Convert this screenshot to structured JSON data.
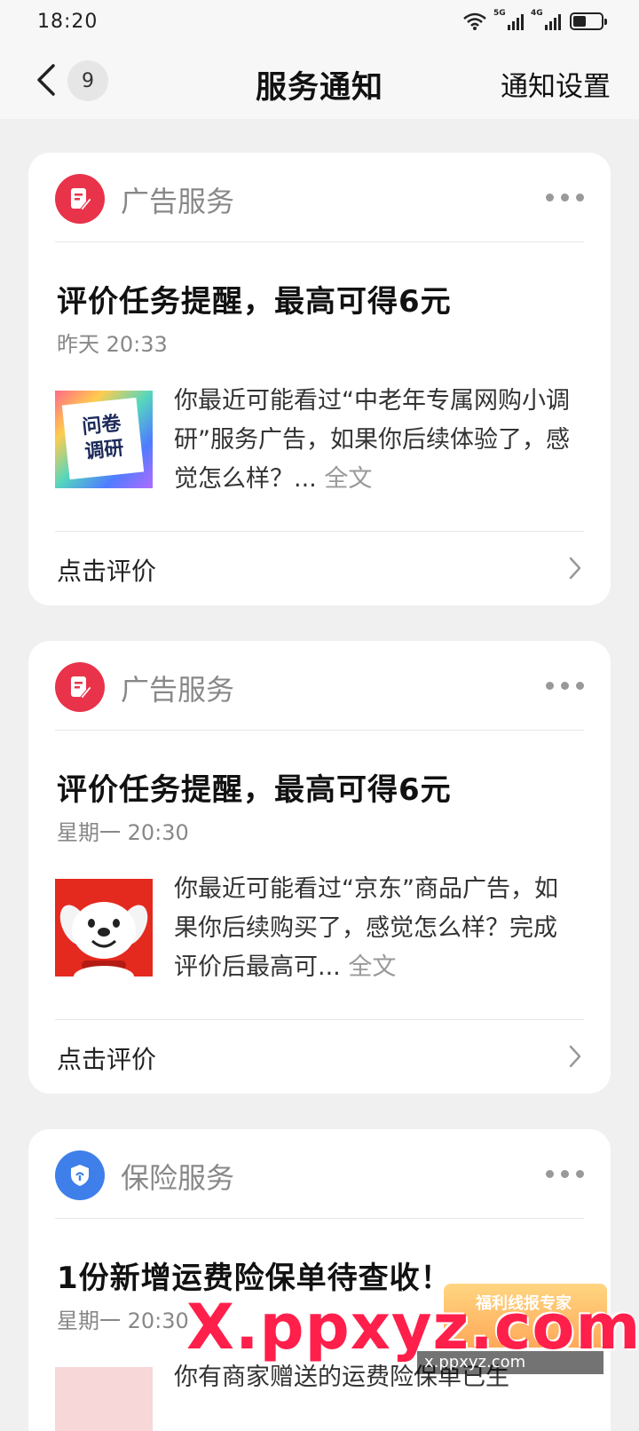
{
  "status_bar": {
    "time": "18:20",
    "signal_1_label": "5G",
    "signal_2_label": "4G",
    "icons": [
      "wifi-icon",
      "signal-icon",
      "signal-icon",
      "battery-icon"
    ]
  },
  "header": {
    "back_icon": "chevron-left-icon",
    "unread_count": "9",
    "title": "服务通知",
    "settings_label": "通知设置"
  },
  "notifications": [
    {
      "service_name": "广告服务",
      "service_icon": "document-pen-icon",
      "title": "评价任务提醒，最高可得6元",
      "time": "昨天 20:33",
      "thumbnail": "survey-thumbnail",
      "thumbnail_text_1": "问卷",
      "thumbnail_text_2": "调研",
      "body": "你最近可能看过“中老年专属网购小调研”服务广告，如果你后续体验了，感觉怎么样？...",
      "full_text_label": "全文",
      "action_label": "点击评价"
    },
    {
      "service_name": "广告服务",
      "service_icon": "document-pen-icon",
      "title": "评价任务提醒，最高可得6元",
      "time": "星期一 20:30",
      "thumbnail": "jd-dog-thumbnail",
      "body": "你最近可能看过“京东”商品广告，如果你后续购买了，感觉怎么样？完成评价后最高可...",
      "full_text_label": "全文",
      "action_label": "点击评价"
    },
    {
      "service_name": "保险服务",
      "service_icon": "shield-icon",
      "title": "1份新增运费险保单待查收！",
      "time": "星期一 20:30",
      "body": "你有商家赠送的运费险保单已生"
    }
  ],
  "watermark": {
    "text": "X.ppxyz.com",
    "brand": "福利线报专家",
    "url": "x.ppxyz.com"
  },
  "colors": {
    "background": "#f0f0f0",
    "card": "#ffffff",
    "ad_service_icon": "#e8334a",
    "insurance_service_icon": "#3e7fea",
    "watermark": "#ff1f4b"
  }
}
